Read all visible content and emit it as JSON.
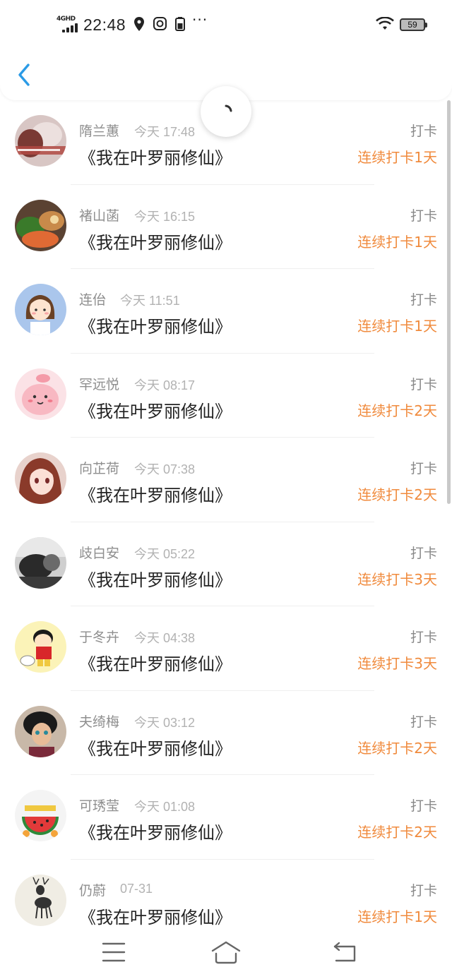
{
  "status_bar": {
    "network": "4GHD",
    "time": "22:48",
    "battery": "59",
    "icons": [
      "signal-icon",
      "location-icon",
      "notification-app-icon",
      "sim-icon",
      "more-dots-icon",
      "wifi-icon",
      "battery-icon"
    ]
  },
  "header": {
    "back_icon": "chevron-left-icon",
    "accent_color": "#2b9be6"
  },
  "list": {
    "items": [
      {
        "name": "隋兰蕙",
        "time": "今天 17:48",
        "title": "《我在叶罗丽修仙》",
        "action": "打卡",
        "streak": "连续打卡1天",
        "avatar": "avatar-photo-text"
      },
      {
        "name": "褚山菡",
        "time": "今天 16:15",
        "title": "《我在叶罗丽修仙》",
        "action": "打卡",
        "streak": "连续打卡1天",
        "avatar": "avatar-food"
      },
      {
        "name": "连佁",
        "time": "今天 11:51",
        "title": "《我在叶罗丽修仙》",
        "action": "打卡",
        "streak": "连续打卡1天",
        "avatar": "avatar-cartoon-girl"
      },
      {
        "name": "罕远悦",
        "time": "今天 08:17",
        "title": "《我在叶罗丽修仙》",
        "action": "打卡",
        "streak": "连续打卡2天",
        "avatar": "avatar-pink-blob"
      },
      {
        "name": "向芷荷",
        "time": "今天 07:38",
        "title": "《我在叶罗丽修仙》",
        "action": "打卡",
        "streak": "连续打卡2天",
        "avatar": "avatar-anime-girl"
      },
      {
        "name": "歧白安",
        "time": "今天 05:22",
        "title": "《我在叶罗丽修仙》",
        "action": "打卡",
        "streak": "连续打卡3天",
        "avatar": "avatar-grayscale"
      },
      {
        "name": "于冬卉",
        "time": "今天 04:38",
        "title": "《我在叶罗丽修仙》",
        "action": "打卡",
        "streak": "连续打卡3天",
        "avatar": "avatar-crayon-boy"
      },
      {
        "name": "夫绮梅",
        "time": "今天 03:12",
        "title": "《我在叶罗丽修仙》",
        "action": "打卡",
        "streak": "连续打卡2天",
        "avatar": "avatar-person"
      },
      {
        "name": "可琇莹",
        "time": "今天 01:08",
        "title": "《我在叶罗丽修仙》",
        "action": "打卡",
        "streak": "连续打卡2天",
        "avatar": "avatar-watermelon"
      },
      {
        "name": "仍蔚",
        "time": "07-31",
        "title": "《我在叶罗丽修仙》",
        "action": "打卡",
        "streak": "连续打卡1天",
        "avatar": "avatar-deer"
      }
    ]
  },
  "colors": {
    "streak": "#f08a3c",
    "name": "#8e8e8e",
    "title": "#222222"
  },
  "nav_bar": {
    "icons": [
      "menu-icon",
      "home-icon",
      "back-nav-icon"
    ]
  }
}
